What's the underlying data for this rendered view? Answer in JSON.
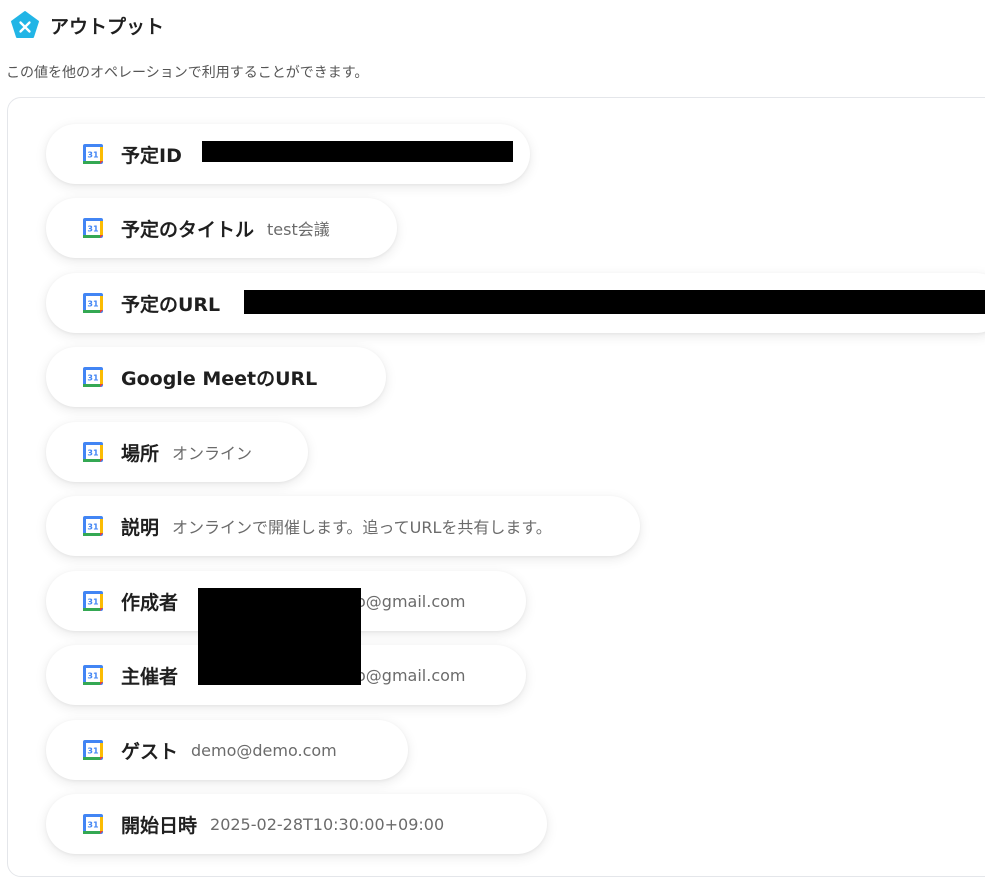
{
  "header": {
    "title": "アウトプット",
    "subtitle": "この値を他のオペレーションで利用することができます。"
  },
  "outputs": [
    {
      "label": "予定ID",
      "value": ""
    },
    {
      "label": "予定のタイトル",
      "value": "test会議"
    },
    {
      "label": "予定のURL",
      "value": ""
    },
    {
      "label": "Google MeetのURL",
      "value": ""
    },
    {
      "label": "場所",
      "value": "オンライン"
    },
    {
      "label": "説明",
      "value": "オンラインで開催します。追ってURLを共有します。"
    },
    {
      "label": "作成者",
      "value": "o@gmail.com"
    },
    {
      "label": "主催者",
      "value": "o@gmail.com"
    },
    {
      "label": "ゲスト",
      "value": "demo@demo.com"
    },
    {
      "label": "開始日時",
      "value": "2025-02-28T10:30:00+09:00"
    }
  ],
  "icons": {
    "brand": "yoom-pentagon-icon",
    "calendar": "google-calendar-icon",
    "calendar_day": "31"
  },
  "colors": {
    "brand": "#22b5e6",
    "calendar_blue": "#4285f4",
    "calendar_red": "#ea4335",
    "calendar_yellow": "#fbbc04",
    "calendar_green": "#34a853"
  }
}
